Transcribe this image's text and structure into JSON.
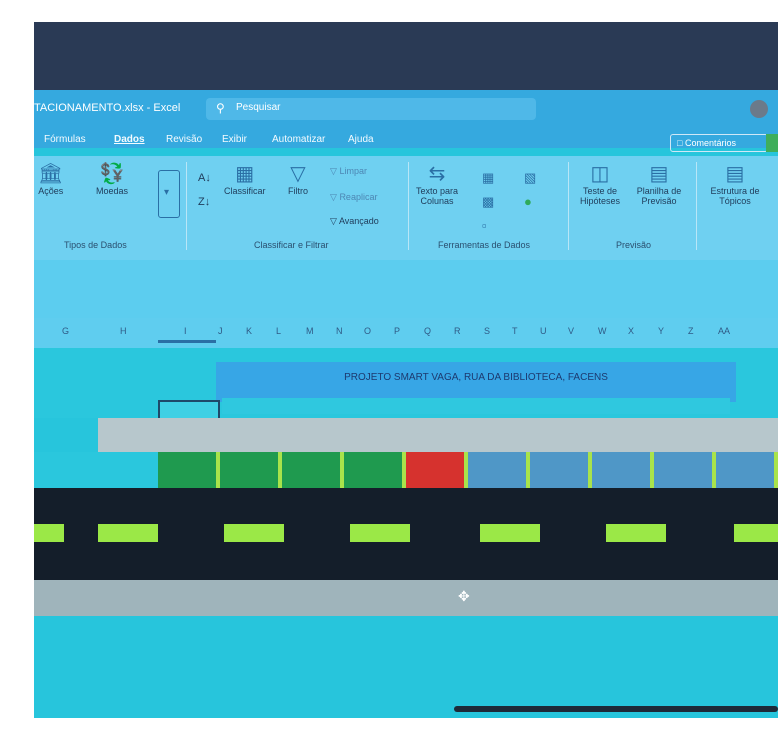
{
  "window": {
    "doc_title": "TACIONAMENTO.xlsx - Excel",
    "search_placeholder": "Pesquisar"
  },
  "tabs": [
    {
      "label": "Fórmulas",
      "active": false
    },
    {
      "label": "Dados",
      "active": true
    },
    {
      "label": "Revisão",
      "active": false
    },
    {
      "label": "Exibir",
      "active": false
    },
    {
      "label": "Automatizar",
      "active": false
    },
    {
      "label": "Ajuda",
      "active": false
    }
  ],
  "comments_label": "Comentários",
  "ribbon": {
    "buttons": [
      {
        "label": "Ações",
        "icon": "stocks-icon"
      },
      {
        "label": "Moedas",
        "icon": "currencies-icon"
      },
      {
        "label": "Classificar",
        "icon": "sort-icon"
      },
      {
        "label": "Filtro",
        "icon": "filter-icon"
      },
      {
        "label": "Limpar",
        "icon": "clear-filter-icon"
      },
      {
        "label": "Reaplicar",
        "icon": "reapply-icon"
      },
      {
        "label": "Avançado",
        "icon": "advanced-filter-icon"
      },
      {
        "label": "Texto para Colunas",
        "icon": "text-to-columns-icon"
      },
      {
        "label": "Teste de Hipóteses",
        "icon": "what-if-icon"
      },
      {
        "label": "Planilha de Previsão",
        "icon": "forecast-sheet-icon"
      },
      {
        "label": "Estrutura de Tópicos",
        "icon": "outline-icon"
      }
    ],
    "groups": [
      "Tipos de Dados",
      "Classificar e Filtrar",
      "Ferramentas de Dados",
      "Previsão"
    ]
  },
  "columns": [
    "G",
    "H",
    "I",
    "J",
    "K",
    "L",
    "M",
    "N",
    "O",
    "P",
    "Q",
    "R",
    "S",
    "T",
    "U",
    "V",
    "W",
    "X",
    "Y",
    "Z",
    "AA"
  ],
  "sheet": {
    "banner_text": "PROJETO SMART VAGA, RUA DA BIBLIOTECA, FACENS"
  },
  "parking_slots": [
    {
      "status": "free",
      "color": "#1f9a4f"
    },
    {
      "status": "free",
      "color": "#1f9a4f"
    },
    {
      "status": "free",
      "color": "#1f9a4f"
    },
    {
      "status": "free",
      "color": "#1f9a4f"
    },
    {
      "status": "occupied",
      "color": "#d6322e"
    },
    {
      "status": "unknown",
      "color": "#4f97c7"
    },
    {
      "status": "unknown",
      "color": "#4f97c7"
    },
    {
      "status": "unknown",
      "color": "#4f97c7"
    },
    {
      "status": "unknown",
      "color": "#4f97c7"
    },
    {
      "status": "unknown",
      "color": "#4f97c7"
    }
  ],
  "colors": {
    "divider": "#a9e34b",
    "road": "#141e2a",
    "lane_marking": "#9be847"
  }
}
